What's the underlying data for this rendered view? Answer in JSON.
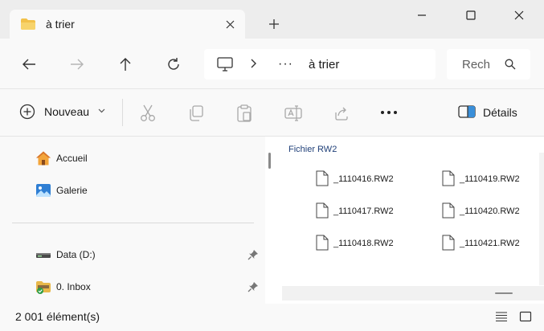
{
  "window": {
    "tab_title": "à trier",
    "controls": {
      "new_tab": "+",
      "minimize": "minimize-icon",
      "maximize": "maximize-icon",
      "close": "close-icon"
    }
  },
  "navigation": {
    "buttons": [
      "back-arrow-icon",
      "forward-arrow-icon",
      "up-arrow-icon",
      "refresh-icon"
    ],
    "address": {
      "root_icon": "computer-icon",
      "separator": "›",
      "overflow": "···",
      "current": "à trier"
    },
    "search": {
      "placeholder": "Rech",
      "icon": "search-icon"
    }
  },
  "command_bar": {
    "new_label": "Nouveau",
    "actions": [
      "cut-icon",
      "copy-icon",
      "paste-icon",
      "rename-icon",
      "share-icon"
    ],
    "more": "•••",
    "details_label": "Détails"
  },
  "sidebar": {
    "items": [
      {
        "label": "Accueil",
        "icon": "home-icon"
      },
      {
        "label": "Galerie",
        "icon": "gallery-icon"
      },
      {
        "label": "Data (D:)",
        "icon": "drive-icon",
        "pinned": true
      },
      {
        "label": "0. Inbox",
        "icon": "inbox-folder-icon",
        "pinned": true
      }
    ]
  },
  "content": {
    "group_header": "Fichier RW2",
    "files": [
      "_1110416.RW2",
      "_1110419.RW2",
      "_1110417.RW2",
      "_1110420.RW2",
      "_1110418.RW2",
      "_1110421.RW2"
    ]
  },
  "status": {
    "item_count": "2 001 élément(s)",
    "views": [
      "details-view-icon",
      "tiles-view-icon"
    ]
  },
  "colors": {
    "accent_folder": "#f2c14a",
    "group_header": "#1f3f78",
    "chrome_background": "#ededed",
    "pane_background": "#f9f9f9"
  }
}
